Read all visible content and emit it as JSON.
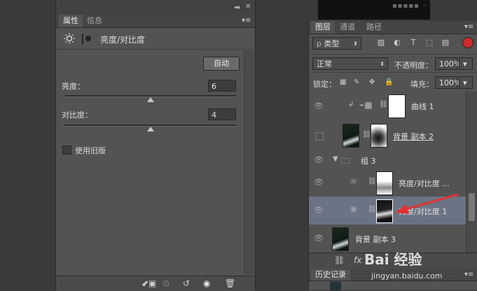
{
  "properties_panel": {
    "tabs": [
      "属性",
      "信息"
    ],
    "header_title": "亮度/对比度",
    "auto_button": "自动",
    "brightness": {
      "label": "亮度：",
      "value": "6",
      "slider_fraction": 0.5
    },
    "contrast": {
      "label": "对比度：",
      "value": "4",
      "slider_fraction": 0.5
    },
    "legacy_checkbox": {
      "label": "使用旧版",
      "checked": false
    }
  },
  "layers_panel": {
    "tabs": [
      "图层",
      "通道",
      "路径"
    ],
    "filter_kind": "类型",
    "blend_mode": "正常",
    "opacity_label": "不透明度：",
    "opacity_value": "100%",
    "lock_label": "锁定：",
    "fill_label": "填充：",
    "fill_value": "100%",
    "layers": [
      {
        "name": "曲线 1",
        "type": "curves",
        "visible": true,
        "selected": false
      },
      {
        "name": "背景 副本 2",
        "type": "image",
        "visible": false,
        "selected": false
      },
      {
        "name": "组 3",
        "type": "group",
        "visible": true,
        "selected": false
      },
      {
        "name": "亮度/对比度 ...",
        "type": "brightness",
        "visible": true,
        "selected": false
      },
      {
        "name": "亮度/对比度 1",
        "type": "brightness",
        "visible": true,
        "selected": true
      },
      {
        "name": "背景 副本 3",
        "type": "image",
        "visible": true,
        "selected": false
      }
    ],
    "footer_fx": "fx"
  },
  "history_panel": {
    "tab": "历史记录"
  },
  "watermark": {
    "brand": "Bai 经验",
    "url": "jingyan.baidu.com"
  },
  "colors": {
    "panel_bg": "#535353",
    "selected_row": "#6b7484",
    "red_arrow": "#e23333"
  }
}
